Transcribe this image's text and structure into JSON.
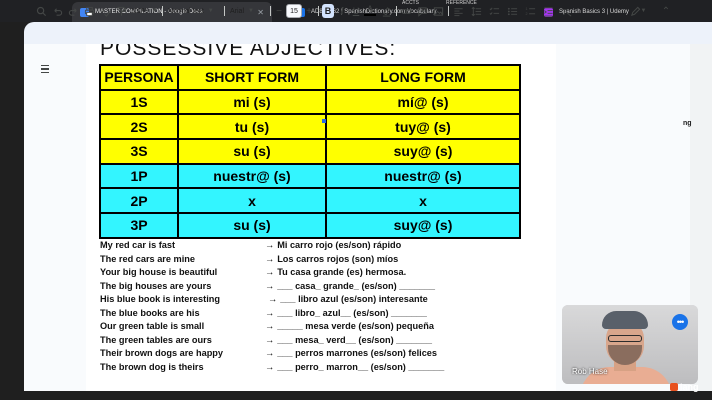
{
  "browser": {
    "tabs": [
      {
        "label": "MASTER COMPILATION - Google Docs",
        "color": "#4285f4"
      },
      {
        "label": "AD831762 | SpanishDictionary.com Vocabulary",
        "color": "#1a73e8"
      },
      {
        "label": "Spanish Basics 3 | Udemy",
        "color": "#a435f0"
      }
    ],
    "mini_tabs": [
      "ACCTS",
      "REFERENCE"
    ]
  },
  "toolbar": {
    "zoom": "100%",
    "style": "Normal text",
    "font": "Arial",
    "font_size": "15",
    "minus": "−",
    "plus": "+",
    "bold": "B",
    "italic": "I",
    "underline": "U",
    "text_color": "A"
  },
  "document": {
    "heading": "POSSESSIVE ADJECTIVES:",
    "table": {
      "headers": [
        "PERSONA",
        "SHORT FORM",
        "LONG FORM"
      ],
      "rows": [
        {
          "persona": "1S",
          "short": "mi (s)",
          "long": "mí@ (s)",
          "color": "yellow"
        },
        {
          "persona": "2S",
          "short": "tu (s)",
          "long": "tuy@ (s)",
          "color": "yellow"
        },
        {
          "persona": "3S",
          "short": "su (s)",
          "long": "suy@ (s)",
          "color": "yellow"
        },
        {
          "persona": "1P",
          "short": "nuestr@ (s)",
          "long": "nuestr@ (s)",
          "color": "cyan"
        },
        {
          "persona": "2P",
          "short": "x",
          "long": "x",
          "color": "cyan"
        },
        {
          "persona": "3P",
          "short": "su (s)",
          "long": "suy@ (s)",
          "color": "cyan"
        }
      ]
    },
    "exercises": [
      {
        "english": "My red car is fast",
        "spanish": "Mi carro rojo (es/son) rápido"
      },
      {
        "english": "The red cars are mine",
        "spanish": "Los carros rojos (son) míos"
      },
      {
        "english": "Your big house is beautiful",
        "spanish": "Tu casa grande (es) hermosa."
      },
      {
        "english": "The big houses are yours",
        "spanish": "___ casa_ grande_ (es/son) _______"
      },
      {
        "english": "His blue book is interesting",
        "spanish": "___ libro azul (es/son) interesante"
      },
      {
        "english": "The blue books are his",
        "spanish": "___ libro_ azul__ (es/son) _______"
      },
      {
        "english": "Our green table is small",
        "spanish": "_____ mesa verde (es/son) pequeña"
      },
      {
        "english": "The green tables are ours",
        "spanish": "___ mesa_ verd__ (es/son) _______"
      },
      {
        "english": "Their brown dogs are happy",
        "spanish": "___ perros marrones (es/son) felices"
      },
      {
        "english": "The brown dog is theirs",
        "spanish": "___ perro_ marron__ (es/son) _______"
      }
    ],
    "arrow": "→"
  },
  "webcam": {
    "name": "Rob Hase",
    "menu": "•••"
  },
  "branding": {
    "logo": "lang",
    "side": "ng"
  }
}
